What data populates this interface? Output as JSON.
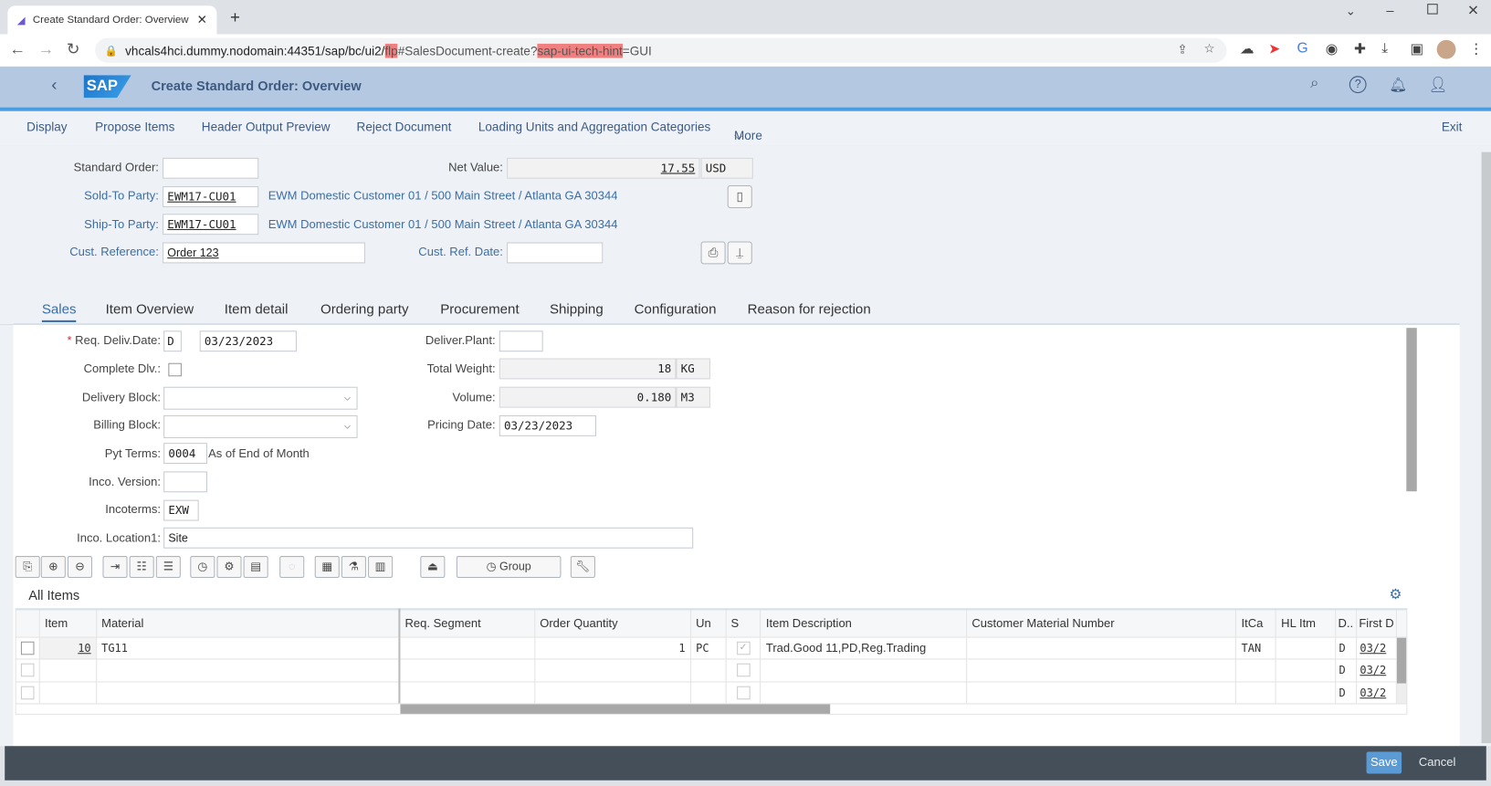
{
  "browser": {
    "tab_title": "Create Standard Order: Overview",
    "url_prefix": "vhcals4hci.dummy.nodomain:44351/sap/bc/ui2/",
    "url_hl1": "flp",
    "url_mid": "#SalesDocument-create?",
    "url_hl2": "sap-ui-tech-hint",
    "url_suffix": "=GUI"
  },
  "shell": {
    "title": "Create Standard Order: Overview",
    "logo": "SAP"
  },
  "toolbar": {
    "items": [
      "Display",
      "Propose Items",
      "Header Output Preview",
      "Reject Document",
      "Loading Units and Aggregation Categories",
      "More"
    ],
    "exit": "Exit"
  },
  "header": {
    "standard_order_label": "Standard Order:",
    "standard_order_value": "",
    "net_value_label": "Net Value:",
    "net_value": "17.55",
    "currency": "USD",
    "sold_to_label": "Sold-To Party:",
    "sold_to": "EWM17-CU01",
    "sold_to_desc": "EWM Domestic Customer 01 / 500 Main Street / Atlanta GA 30344",
    "ship_to_label": "Ship-To Party:",
    "ship_to": "EWM17-CU01",
    "ship_to_desc": "EWM Domestic Customer 01 / 500 Main Street / Atlanta GA 30344",
    "cust_ref_label": "Cust. Reference:",
    "cust_ref": "Order 123",
    "cust_ref_date_label": "Cust. Ref. Date:",
    "cust_ref_date": ""
  },
  "tabs": [
    "Sales",
    "Item Overview",
    "Item detail",
    "Ordering party",
    "Procurement",
    "Shipping",
    "Configuration",
    "Reason for rejection"
  ],
  "active_tab": "Sales",
  "sales": {
    "req_deliv_label": "Req. Deliv.Date:",
    "req_deliv_type": "D",
    "req_deliv_date": "03/23/2023",
    "complete_dlv_label": "Complete Dlv.:",
    "complete_dlv": false,
    "delivery_block_label": "Delivery Block:",
    "delivery_block": "",
    "billing_block_label": "Billing Block:",
    "billing_block": "",
    "pyt_terms_label": "Pyt Terms:",
    "pyt_terms": "0004",
    "pyt_terms_desc": "As of End of Month",
    "inco_version_label": "Inco. Version:",
    "inco_version": "",
    "incoterms_label": "Incoterms:",
    "incoterms": "EXW",
    "inco_loc_label": "Inco. Location1:",
    "inco_loc": "Site",
    "deliver_plant_label": "Deliver.Plant:",
    "deliver_plant": "",
    "total_weight_label": "Total Weight:",
    "total_weight": "18",
    "weight_unit": "KG",
    "volume_label": "Volume:",
    "volume": "0.180",
    "volume_unit": "M3",
    "pricing_date_label": "Pricing Date:",
    "pricing_date": "03/23/2023"
  },
  "items_toolbar": {
    "group_label": "Group"
  },
  "items": {
    "title": "All Items",
    "columns": [
      "Item",
      "Material",
      "Req. Segment",
      "Order Quantity",
      "Un",
      "S",
      "Item Description",
      "Customer Material Number",
      "ItCa",
      "HL Itm",
      "D..",
      "First D"
    ],
    "rows": [
      {
        "item": "10",
        "material": "TG11",
        "req_segment": "",
        "qty": "1",
        "unit": "PC",
        "s": true,
        "desc": "Trad.Good 11,PD,Reg.Trading",
        "cust_mat": "",
        "itca": "TAN",
        "hl": "",
        "d": "D",
        "first": "03/2"
      },
      {
        "item": "",
        "material": "",
        "req_segment": "",
        "qty": "",
        "unit": "",
        "s": false,
        "desc": "",
        "cust_mat": "",
        "itca": "",
        "hl": "",
        "d": "D",
        "first": "03/2"
      },
      {
        "item": "",
        "material": "",
        "req_segment": "",
        "qty": "",
        "unit": "",
        "s": false,
        "desc": "",
        "cust_mat": "",
        "itca": "",
        "hl": "",
        "d": "D",
        "first": "03/2"
      }
    ]
  },
  "footer": {
    "save": "Save",
    "cancel": "Cancel"
  },
  "colors": {
    "shell": "#b4c8e2",
    "accent": "#4a9ee0",
    "footer": "#454f5a",
    "save": "#5b9bd5",
    "link": "#3a6ea5"
  }
}
